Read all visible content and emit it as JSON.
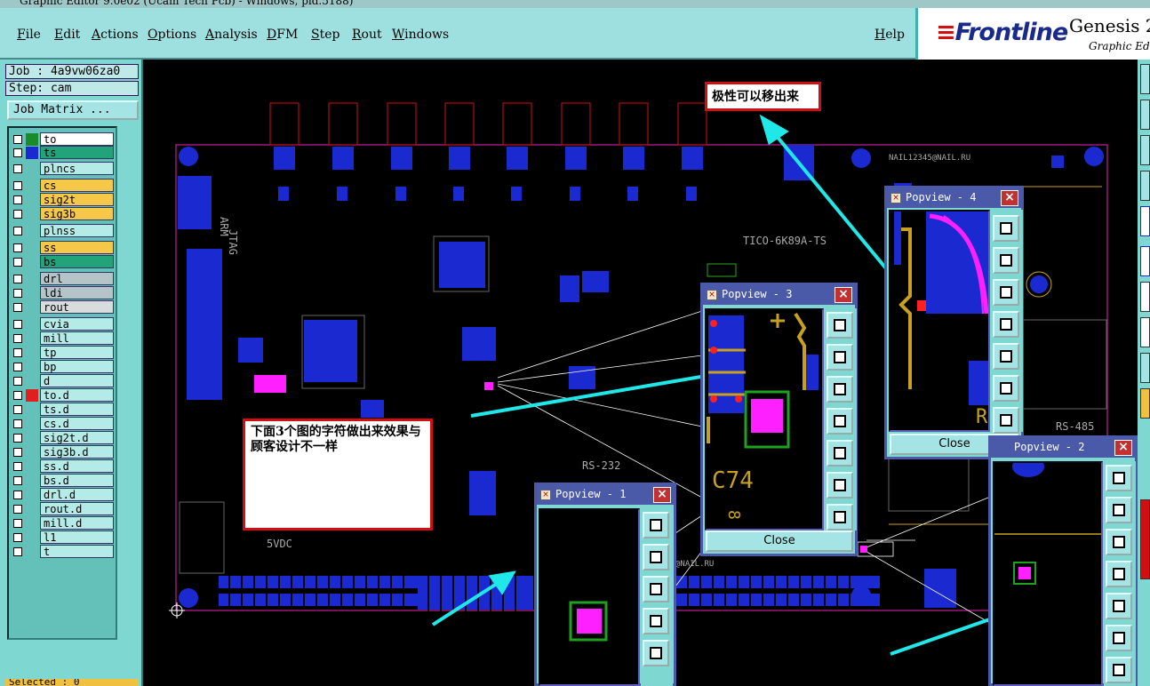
{
  "window": {
    "title": "Graphic Editor 9.0e02 (Ucam Tech Pcb) - Windows, pid.5188)"
  },
  "menu": [
    "File",
    "Edit",
    "Actions",
    "Options",
    "Analysis",
    "DFM",
    "Step",
    "Rout",
    "Windows"
  ],
  "help": "Help",
  "brand": {
    "logo": "Frontline",
    "product": "Genesis 2",
    "sub": "Graphic Edi"
  },
  "job": {
    "job": "Job : 4a9vw06za0",
    "step": "Step: cam",
    "matrix_button": "Job Matrix ..."
  },
  "layers": [
    {
      "name": "to",
      "style": "wt",
      "swatch": "#1a8a2a",
      "boxed": true
    },
    {
      "name": "ts",
      "style": "gr",
      "swatch": "#1a2ad0"
    },
    {
      "name": "plncs",
      "style": ""
    },
    {
      "name": "cs",
      "style": "yl"
    },
    {
      "name": "sig2t",
      "style": "yl"
    },
    {
      "name": "sig3b",
      "style": "yl"
    },
    {
      "name": "plnss",
      "style": ""
    },
    {
      "name": "ss",
      "style": "yl"
    },
    {
      "name": "bs",
      "style": "gr"
    },
    {
      "name": "drl",
      "style": "gy"
    },
    {
      "name": "ldi",
      "style": "gy"
    },
    {
      "name": "rout",
      "style": "lgy"
    },
    {
      "name": "cvia",
      "style": ""
    },
    {
      "name": "mill",
      "style": ""
    },
    {
      "name": "tp",
      "style": ""
    },
    {
      "name": "bp",
      "style": ""
    },
    {
      "name": "d",
      "style": ""
    },
    {
      "name": "to.d",
      "style": "",
      "swatch": "#e02020"
    },
    {
      "name": "ts.d",
      "style": ""
    },
    {
      "name": "cs.d",
      "style": ""
    },
    {
      "name": "sig2t.d",
      "style": ""
    },
    {
      "name": "sig3b.d",
      "style": ""
    },
    {
      "name": "ss.d",
      "style": ""
    },
    {
      "name": "bs.d",
      "style": ""
    },
    {
      "name": "drl.d",
      "style": ""
    },
    {
      "name": "rout.d",
      "style": ""
    },
    {
      "name": "mill.d",
      "style": ""
    },
    {
      "name": "l1",
      "style": ""
    },
    {
      "name": "t",
      "style": ""
    }
  ],
  "status": {
    "selected": "Selected : 0"
  },
  "annotations": {
    "polarity": "极性可以移出来",
    "note": "下面3个图的字符做出来效果与顾客设计不一样"
  },
  "board_text": {
    "nail": "NAIL12345@NAIL.RU",
    "nail2": "@NAIL.RU",
    "part": "TICO-6K89A-TS",
    "arm": "ARM",
    "jtag": "JTAG",
    "rs232": "RS-232",
    "rs485": "RS-485",
    "svdc": "5VDC"
  },
  "popviews": [
    {
      "title": "Popview - 1"
    },
    {
      "title": "Popview - 2"
    },
    {
      "title": "Popview - 3",
      "close": "Close",
      "label": "C74"
    },
    {
      "title": "Popview - 4",
      "close": "Close"
    }
  ],
  "colors": {
    "ui_bg": "#7ed7d0",
    "popup_title": "#4a5aa8",
    "pad_blue": "#1a2ad0",
    "magenta": "#ff20ff",
    "copper": "#c8a020",
    "outline": "#c0209a",
    "arrow": "#20e8e8"
  }
}
